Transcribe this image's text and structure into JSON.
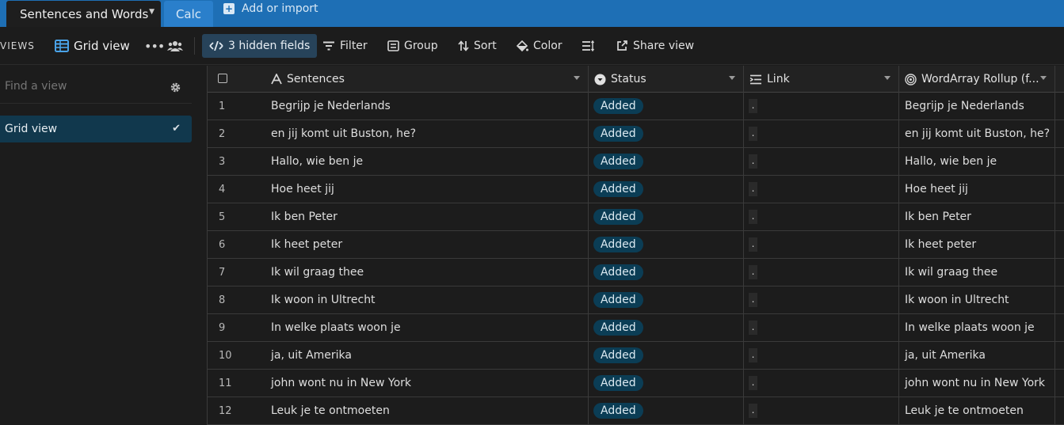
{
  "tabs": {
    "active_label": "Sentences and Words",
    "second_label": "Calc",
    "add_import_label": "Add or import"
  },
  "toolbar": {
    "views_label": "VIEWS",
    "view_name": "Grid view",
    "more_label": "•••",
    "hidden_fields_label": "3 hidden fields",
    "filter_label": "Filter",
    "group_label": "Group",
    "sort_label": "Sort",
    "color_label": "Color",
    "share_label": "Share view"
  },
  "sidebar": {
    "find_placeholder": "Find a view",
    "views": [
      {
        "label": "Grid view",
        "selected": true
      }
    ]
  },
  "grid": {
    "columns": [
      {
        "label": "Sentences",
        "icon": "text-a-icon"
      },
      {
        "label": "Status",
        "icon": "single-select-icon"
      },
      {
        "label": "Link",
        "icon": "link-list-icon"
      },
      {
        "label": "WordArray Rollup (f...",
        "icon": "rollup-icon"
      }
    ],
    "rows": [
      {
        "num": "1",
        "sentence": "Begrijp je Nederlands",
        "status": "Added",
        "link": ".",
        "rollup": "Begrijp je Nederlands"
      },
      {
        "num": "2",
        "sentence": "en jij komt uit Buston, he?",
        "status": "Added",
        "link": ".",
        "rollup": "en jij komt uit Buston, he?"
      },
      {
        "num": "3",
        "sentence": "Hallo, wie ben je",
        "status": "Added",
        "link": ".",
        "rollup": "Hallo, wie ben je"
      },
      {
        "num": "4",
        "sentence": "Hoe heet jij",
        "status": "Added",
        "link": ".",
        "rollup": "Hoe heet jij"
      },
      {
        "num": "5",
        "sentence": "Ik ben Peter",
        "status": "Added",
        "link": ".",
        "rollup": "Ik ben Peter"
      },
      {
        "num": "6",
        "sentence": "Ik heet peter",
        "status": "Added",
        "link": ".",
        "rollup": "Ik heet peter"
      },
      {
        "num": "7",
        "sentence": "Ik wil graag thee",
        "status": "Added",
        "link": ".",
        "rollup": "Ik wil graag thee"
      },
      {
        "num": "8",
        "sentence": "Ik woon in Ultrecht",
        "status": "Added",
        "link": ".",
        "rollup": "Ik woon in Ultrecht"
      },
      {
        "num": "9",
        "sentence": "In welke plaats woon je",
        "status": "Added",
        "link": ".",
        "rollup": "In welke plaats woon je"
      },
      {
        "num": "10",
        "sentence": "ja, uit Amerika",
        "status": "Added",
        "link": ".",
        "rollup": "ja, uit Amerika"
      },
      {
        "num": "11",
        "sentence": "john wont nu in New York",
        "status": "Added",
        "link": ".",
        "rollup": "john wont nu in New York"
      },
      {
        "num": "12",
        "sentence": "Leuk je te ontmoeten",
        "status": "Added",
        "link": ".",
        "rollup": "Leuk je te ontmoeten"
      }
    ]
  },
  "colors": {
    "tabbar": "#1e6fb5",
    "background": "#1c1c1c",
    "hidden_fields_button": "#27435a",
    "selected_view": "#11384d",
    "status_pill": "#0b3d55"
  }
}
